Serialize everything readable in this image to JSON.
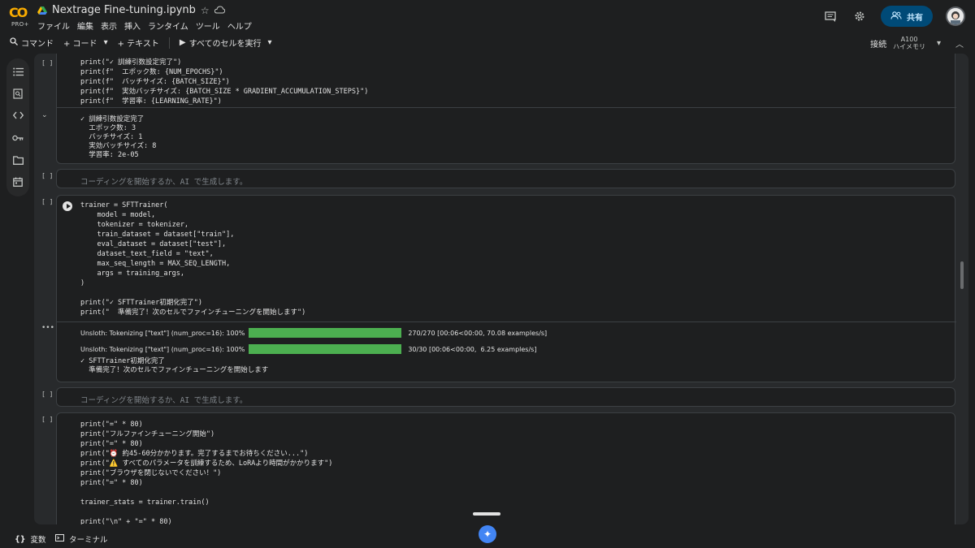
{
  "app": {
    "logo_text": "CO",
    "plan_badge": "PRO+",
    "notebook_title": "Nextrage Fine-tuning.ipynb"
  },
  "menu": [
    "ファイル",
    "編集",
    "表示",
    "挿入",
    "ランタイム",
    "ツール",
    "ヘルプ"
  ],
  "header_right": {
    "share_label": "共有"
  },
  "toolbar": {
    "command_label": "コマンド",
    "code_label": "+ コード",
    "text_label": "+ テキスト",
    "run_all_label": "すべてのセルを実行",
    "connect_label": "接続",
    "gpu_label": "A100",
    "ram_label": "ハイメモリ"
  },
  "cells": {
    "placeholder": "コーディングを開始するか、AI で生成します。",
    "cell1": {
      "bracket": "[ ]",
      "code": [
        "print(\"✓ 訓練引数設定完了\")",
        "print(f\"  エポック数: {NUM_EPOCHS}\")",
        "print(f\"  バッチサイズ: {BATCH_SIZE}\")",
        "print(f\"  実効バッチサイズ: {BATCH_SIZE * GRADIENT_ACCUMULATION_STEPS}\")",
        "print(f\"  学習率: {LEARNING_RATE}\")"
      ],
      "output": [
        "✓ 訓練引数設定完了",
        "  エポック数: 3",
        "  バッチサイズ: 1",
        "  実効バッチサイズ: 8",
        "  学習率: 2e-05"
      ]
    },
    "cell2": {
      "bracket": "[ ]"
    },
    "cell3": {
      "bracket": "[ ]",
      "code": [
        "trainer = SFTTrainer(",
        "    model = model,",
        "    tokenizer = tokenizer,",
        "    train_dataset = dataset[\"train\"],",
        "    eval_dataset = dataset[\"test\"],",
        "    dataset_text_field = \"text\",",
        "    max_seq_length = MAX_SEQ_LENGTH,",
        "    args = training_args,",
        ")",
        "",
        "print(\"✓ SFTTrainer初期化完了\")",
        "print(\"  準備完了！次のセルでファインチューニングを開始します\")"
      ],
      "progress": [
        {
          "label": "Unsloth: Tokenizing [\"text\"] (num_proc=16): 100%",
          "fraction": 1.0,
          "stats": "270/270 [00:06<00:00, 70.08 examples/s]"
        },
        {
          "label": "Unsloth: Tokenizing [\"text\"] (num_proc=16): 100%",
          "fraction": 1.0,
          "stats": "30/30 [00:06<00:00,  6.25 examples/s]"
        }
      ],
      "output": [
        "✓ SFTTrainer初期化完了",
        "  準備完了！次のセルでファインチューニングを開始します"
      ]
    },
    "cell4": {
      "bracket": "[ ]"
    },
    "cell5": {
      "bracket": "[ ]",
      "code": [
        "print(\"=\" * 80)",
        "print(\"フルファインチューニング開始\")",
        "print(\"=\" * 80)",
        "print(\"⏰ 約45-60分かかります。完了するまでお待ちください...\")",
        "print(\"⚠️ すべてのパラメータを訓練するため、LoRAより時間がかかります\")",
        "print(\"ブラウザを閉じないでください！\")",
        "print(\"=\" * 80)",
        "",
        "trainer_stats = trainer.train()",
        "",
        "print(\"\\n\" + \"=\" * 80)"
      ]
    }
  },
  "bottom": {
    "variables_label": "変数",
    "terminal_label": "ターミナル"
  },
  "colors": {
    "accent": "#004a77",
    "progress": "#4caf50",
    "string": "#f4c06b"
  }
}
